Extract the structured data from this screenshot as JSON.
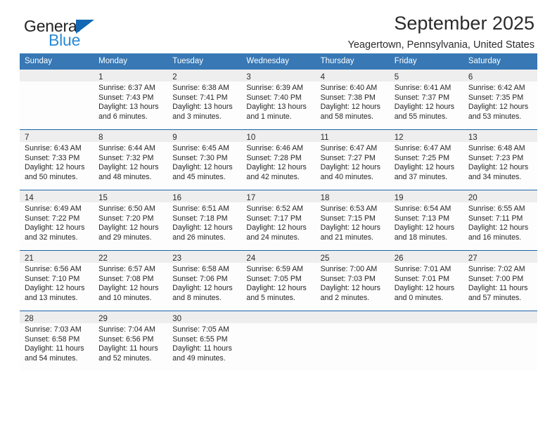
{
  "brand": {
    "name_top": "General",
    "name_bottom": "Blue",
    "accent_color": "#1268b3",
    "accent_color_light": "#2a8ad4"
  },
  "header": {
    "title": "September 2025",
    "subtitle": "Yeagertown, Pennsylvania, United States"
  },
  "calendar": {
    "header_bg": "#3778b5",
    "header_text_color": "#ffffff",
    "week_separator_color": "#1a63a8",
    "daynum_band_color": "#eeeeee",
    "weekdays": [
      "Sunday",
      "Monday",
      "Tuesday",
      "Wednesday",
      "Thursday",
      "Friday",
      "Saturday"
    ],
    "weeks": [
      [
        {
          "day": "",
          "sunrise": "",
          "sunset": "",
          "daylight": "",
          "empty": true
        },
        {
          "day": "1",
          "sunrise": "Sunrise: 6:37 AM",
          "sunset": "Sunset: 7:43 PM",
          "daylight": "Daylight: 13 hours and 6 minutes."
        },
        {
          "day": "2",
          "sunrise": "Sunrise: 6:38 AM",
          "sunset": "Sunset: 7:41 PM",
          "daylight": "Daylight: 13 hours and 3 minutes."
        },
        {
          "day": "3",
          "sunrise": "Sunrise: 6:39 AM",
          "sunset": "Sunset: 7:40 PM",
          "daylight": "Daylight: 13 hours and 1 minute."
        },
        {
          "day": "4",
          "sunrise": "Sunrise: 6:40 AM",
          "sunset": "Sunset: 7:38 PM",
          "daylight": "Daylight: 12 hours and 58 minutes."
        },
        {
          "day": "5",
          "sunrise": "Sunrise: 6:41 AM",
          "sunset": "Sunset: 7:37 PM",
          "daylight": "Daylight: 12 hours and 55 minutes."
        },
        {
          "day": "6",
          "sunrise": "Sunrise: 6:42 AM",
          "sunset": "Sunset: 7:35 PM",
          "daylight": "Daylight: 12 hours and 53 minutes."
        }
      ],
      [
        {
          "day": "7",
          "sunrise": "Sunrise: 6:43 AM",
          "sunset": "Sunset: 7:33 PM",
          "daylight": "Daylight: 12 hours and 50 minutes."
        },
        {
          "day": "8",
          "sunrise": "Sunrise: 6:44 AM",
          "sunset": "Sunset: 7:32 PM",
          "daylight": "Daylight: 12 hours and 48 minutes."
        },
        {
          "day": "9",
          "sunrise": "Sunrise: 6:45 AM",
          "sunset": "Sunset: 7:30 PM",
          "daylight": "Daylight: 12 hours and 45 minutes."
        },
        {
          "day": "10",
          "sunrise": "Sunrise: 6:46 AM",
          "sunset": "Sunset: 7:28 PM",
          "daylight": "Daylight: 12 hours and 42 minutes."
        },
        {
          "day": "11",
          "sunrise": "Sunrise: 6:47 AM",
          "sunset": "Sunset: 7:27 PM",
          "daylight": "Daylight: 12 hours and 40 minutes."
        },
        {
          "day": "12",
          "sunrise": "Sunrise: 6:47 AM",
          "sunset": "Sunset: 7:25 PM",
          "daylight": "Daylight: 12 hours and 37 minutes."
        },
        {
          "day": "13",
          "sunrise": "Sunrise: 6:48 AM",
          "sunset": "Sunset: 7:23 PM",
          "daylight": "Daylight: 12 hours and 34 minutes."
        }
      ],
      [
        {
          "day": "14",
          "sunrise": "Sunrise: 6:49 AM",
          "sunset": "Sunset: 7:22 PM",
          "daylight": "Daylight: 12 hours and 32 minutes."
        },
        {
          "day": "15",
          "sunrise": "Sunrise: 6:50 AM",
          "sunset": "Sunset: 7:20 PM",
          "daylight": "Daylight: 12 hours and 29 minutes."
        },
        {
          "day": "16",
          "sunrise": "Sunrise: 6:51 AM",
          "sunset": "Sunset: 7:18 PM",
          "daylight": "Daylight: 12 hours and 26 minutes."
        },
        {
          "day": "17",
          "sunrise": "Sunrise: 6:52 AM",
          "sunset": "Sunset: 7:17 PM",
          "daylight": "Daylight: 12 hours and 24 minutes."
        },
        {
          "day": "18",
          "sunrise": "Sunrise: 6:53 AM",
          "sunset": "Sunset: 7:15 PM",
          "daylight": "Daylight: 12 hours and 21 minutes."
        },
        {
          "day": "19",
          "sunrise": "Sunrise: 6:54 AM",
          "sunset": "Sunset: 7:13 PM",
          "daylight": "Daylight: 12 hours and 18 minutes."
        },
        {
          "day": "20",
          "sunrise": "Sunrise: 6:55 AM",
          "sunset": "Sunset: 7:11 PM",
          "daylight": "Daylight: 12 hours and 16 minutes."
        }
      ],
      [
        {
          "day": "21",
          "sunrise": "Sunrise: 6:56 AM",
          "sunset": "Sunset: 7:10 PM",
          "daylight": "Daylight: 12 hours and 13 minutes."
        },
        {
          "day": "22",
          "sunrise": "Sunrise: 6:57 AM",
          "sunset": "Sunset: 7:08 PM",
          "daylight": "Daylight: 12 hours and 10 minutes."
        },
        {
          "day": "23",
          "sunrise": "Sunrise: 6:58 AM",
          "sunset": "Sunset: 7:06 PM",
          "daylight": "Daylight: 12 hours and 8 minutes."
        },
        {
          "day": "24",
          "sunrise": "Sunrise: 6:59 AM",
          "sunset": "Sunset: 7:05 PM",
          "daylight": "Daylight: 12 hours and 5 minutes."
        },
        {
          "day": "25",
          "sunrise": "Sunrise: 7:00 AM",
          "sunset": "Sunset: 7:03 PM",
          "daylight": "Daylight: 12 hours and 2 minutes."
        },
        {
          "day": "26",
          "sunrise": "Sunrise: 7:01 AM",
          "sunset": "Sunset: 7:01 PM",
          "daylight": "Daylight: 12 hours and 0 minutes."
        },
        {
          "day": "27",
          "sunrise": "Sunrise: 7:02 AM",
          "sunset": "Sunset: 7:00 PM",
          "daylight": "Daylight: 11 hours and 57 minutes."
        }
      ],
      [
        {
          "day": "28",
          "sunrise": "Sunrise: 7:03 AM",
          "sunset": "Sunset: 6:58 PM",
          "daylight": "Daylight: 11 hours and 54 minutes."
        },
        {
          "day": "29",
          "sunrise": "Sunrise: 7:04 AM",
          "sunset": "Sunset: 6:56 PM",
          "daylight": "Daylight: 11 hours and 52 minutes."
        },
        {
          "day": "30",
          "sunrise": "Sunrise: 7:05 AM",
          "sunset": "Sunset: 6:55 PM",
          "daylight": "Daylight: 11 hours and 49 minutes."
        },
        {
          "day": "",
          "sunrise": "",
          "sunset": "",
          "daylight": "",
          "empty": true
        },
        {
          "day": "",
          "sunrise": "",
          "sunset": "",
          "daylight": "",
          "empty": true
        },
        {
          "day": "",
          "sunrise": "",
          "sunset": "",
          "daylight": "",
          "empty": true
        },
        {
          "day": "",
          "sunrise": "",
          "sunset": "",
          "daylight": "",
          "empty": true
        }
      ]
    ]
  }
}
